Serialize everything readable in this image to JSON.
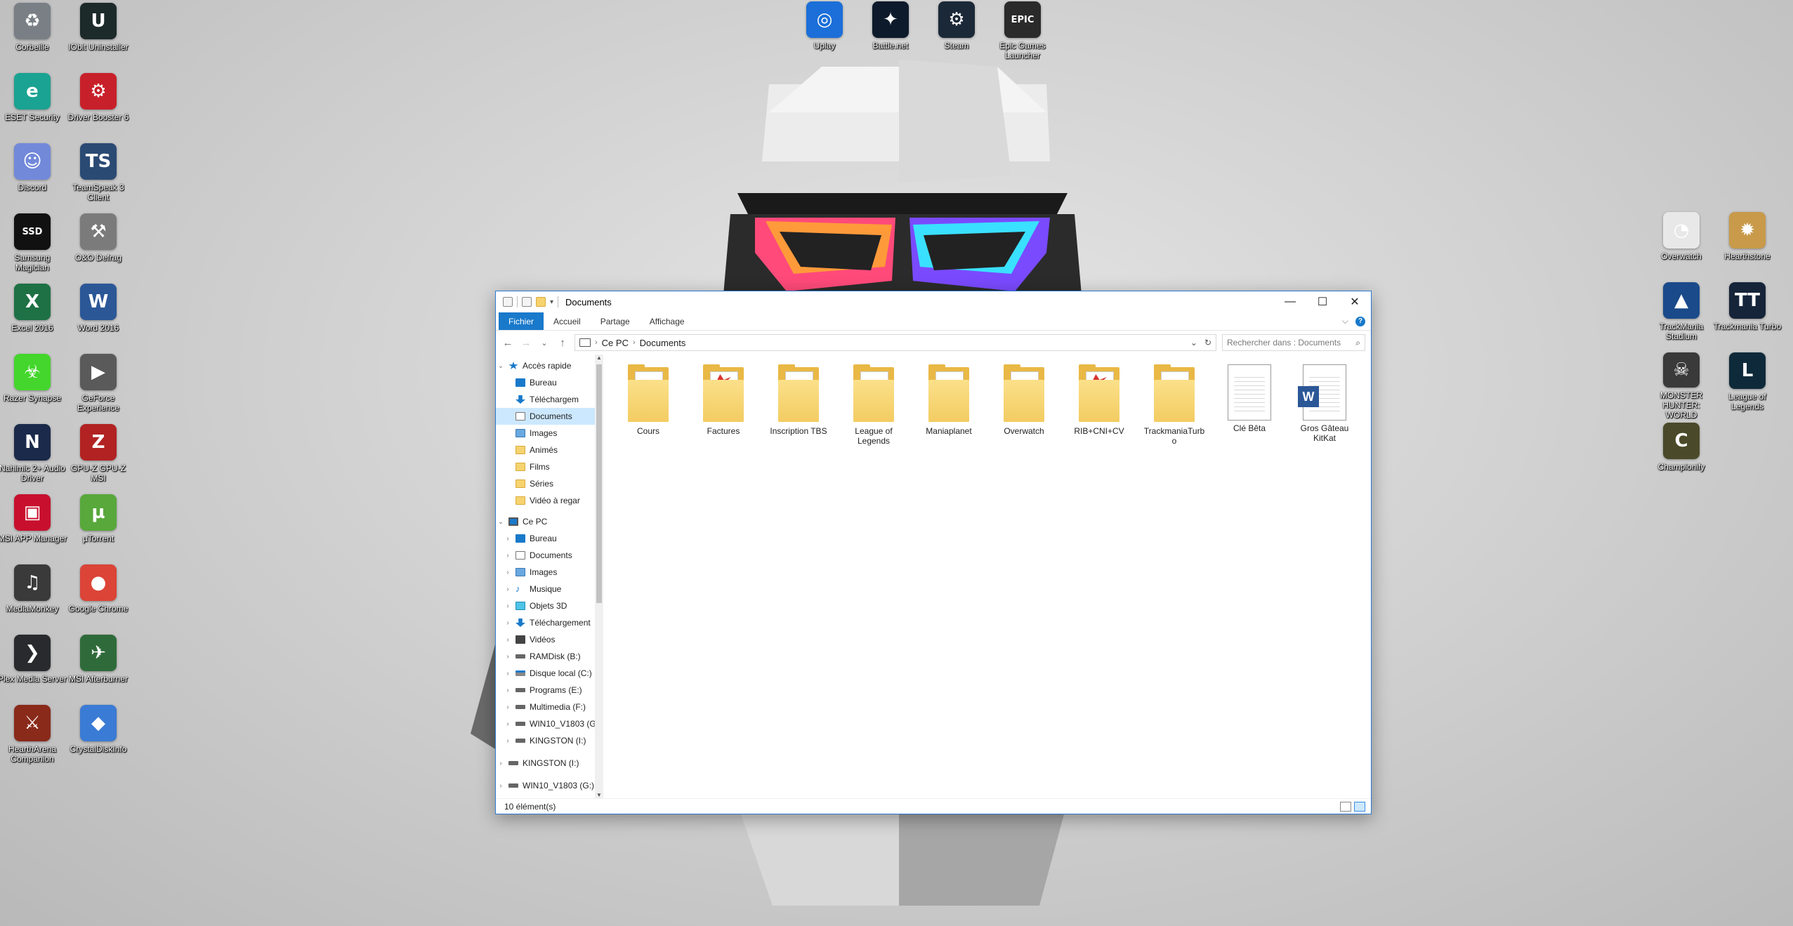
{
  "desktop": {
    "left_icons": [
      {
        "label": "Corbeille",
        "glyph": "♻",
        "color": "#7a7f86",
        "icon": "recycle-bin-icon"
      },
      {
        "label": "IObit Uninstaller",
        "glyph": "U",
        "color": "#1d2a2a",
        "icon": "uninstaller-icon"
      },
      {
        "label": "ESET Security",
        "glyph": "e",
        "color": "#1aa392",
        "icon": "eset-icon"
      },
      {
        "label": "Driver Booster 6",
        "glyph": "⚙",
        "color": "#c8202a",
        "icon": "driver-booster-icon"
      },
      {
        "label": "Discord",
        "glyph": "☺",
        "color": "#7289da",
        "icon": "discord-icon"
      },
      {
        "label": "TeamSpeak 3 Client",
        "glyph": "TS",
        "color": "#2a4a74",
        "icon": "teamspeak-icon"
      },
      {
        "label": "Samsung Magician",
        "glyph": "SSD",
        "color": "#111111",
        "icon": "samsung-magician-icon"
      },
      {
        "label": "O&O Defrag",
        "glyph": "⚒",
        "color": "#7b7b7b",
        "icon": "defrag-icon"
      },
      {
        "label": "Excel 2016",
        "glyph": "X",
        "color": "#1e7145",
        "icon": "excel-icon"
      },
      {
        "label": "Word 2016",
        "glyph": "W",
        "color": "#2b5797",
        "icon": "word-icon"
      },
      {
        "label": "Razer Synapse",
        "glyph": "☣",
        "color": "#44d62c",
        "icon": "razer-synapse-icon"
      },
      {
        "label": "GeForce Experience",
        "glyph": "▶",
        "color": "#5a5a5a",
        "icon": "geforce-icon"
      },
      {
        "label": "Nahimic 2+ Audio Driver",
        "glyph": "N",
        "color": "#1b2a4a",
        "icon": "nahimic-icon"
      },
      {
        "label": "GPU-Z GPU-Z MSI",
        "glyph": "Z",
        "color": "#b22222",
        "icon": "gpu-z-icon"
      },
      {
        "label": "MSI APP Manager",
        "glyph": "▣",
        "color": "#c8102e",
        "icon": "msi-app-manager-icon"
      },
      {
        "label": "µTorrent",
        "glyph": "µ",
        "color": "#58a83b",
        "icon": "utorrent-icon"
      },
      {
        "label": "MediaMonkey",
        "glyph": "♫",
        "color": "#3a3a3a",
        "icon": "mediamonkey-icon"
      },
      {
        "label": "Google Chrome",
        "glyph": "●",
        "color": "#db4437",
        "icon": "chrome-icon"
      },
      {
        "label": "Plex Media Server",
        "glyph": "❯",
        "color": "#282a2d",
        "icon": "plex-icon"
      },
      {
        "label": "MSI Afterburner",
        "glyph": "✈",
        "color": "#2f6b3a",
        "icon": "afterburner-icon"
      },
      {
        "label": "HearthArena Companion",
        "glyph": "⚔",
        "color": "#8a2a1a",
        "icon": "hearth-arena-icon"
      },
      {
        "label": "CrystalDiskInfo",
        "glyph": "◆",
        "color": "#3a7bd5",
        "icon": "crystaldiskinfo-icon"
      }
    ],
    "top_icons": [
      {
        "label": "Uplay",
        "glyph": "◎",
        "color": "#1c6fd8",
        "icon": "uplay-icon"
      },
      {
        "label": "Battle.net",
        "glyph": "✦",
        "color": "#0d1a2b",
        "icon": "battlenet-icon"
      },
      {
        "label": "Steam",
        "glyph": "⚙",
        "color": "#1b2838",
        "icon": "steam-icon"
      },
      {
        "label": "Epic Games Launcher",
        "glyph": "EPIC",
        "color": "#2a2a2a",
        "icon": "epic-games-icon"
      }
    ],
    "right_icons": [
      {
        "label": "Overwatch",
        "glyph": "◔",
        "color": "#e8e8e8",
        "icon": "overwatch-icon"
      },
      {
        "label": "Hearthstone",
        "glyph": "✹",
        "color": "#c89a4a",
        "icon": "hearthstone-icon"
      },
      {
        "label": "TrackMania Stadium",
        "glyph": "▲",
        "color": "#1a4a8a",
        "icon": "trackmania-stadium-icon"
      },
      {
        "label": "Trackmania Turbo",
        "glyph": "TT",
        "color": "#16243a",
        "icon": "trackmania-turbo-icon"
      },
      {
        "label": "MONSTER HUNTER: WORLD",
        "glyph": "☠",
        "color": "#3a3a3a",
        "icon": "monster-hunter-icon"
      },
      {
        "label": "League of Legends",
        "glyph": "L",
        "color": "#0e2a3a",
        "icon": "league-of-legends-icon"
      },
      {
        "label": "Championify",
        "glyph": "C",
        "color": "#4a4a2a",
        "icon": "championify-icon"
      }
    ]
  },
  "window": {
    "title": "Documents",
    "controls": {
      "minimize": "—",
      "maximize": "☐",
      "close": "✕"
    },
    "ribbon": {
      "tabs": [
        "Fichier",
        "Accueil",
        "Partage",
        "Affichage"
      ],
      "expand": "⌵",
      "help": "?"
    },
    "address": {
      "back": "←",
      "forward": "→",
      "recent": "⌄",
      "up": "↑",
      "crumbs": [
        "Ce PC",
        "Documents"
      ],
      "dropdown": "⌄",
      "refresh": "↻",
      "search_placeholder": "Rechercher dans : Documents",
      "search_icon": "⌕"
    },
    "nav": {
      "quick_access": {
        "label": "Accès rapide",
        "items": [
          {
            "label": "Bureau",
            "icon": "blue",
            "pinned": true
          },
          {
            "label": "Téléchargem",
            "icon": "down",
            "pinned": true
          },
          {
            "label": "Documents",
            "icon": "doc",
            "pinned": true,
            "selected": true
          },
          {
            "label": "Images",
            "icon": "img",
            "pinned": true
          },
          {
            "label": "Animés",
            "icon": "folder",
            "pinned": true
          },
          {
            "label": "Films",
            "icon": "folder",
            "pinned": true
          },
          {
            "label": "Séries",
            "icon": "folder",
            "pinned": true
          },
          {
            "label": "Vidéo à regar",
            "icon": "folder",
            "pinned": true
          }
        ]
      },
      "this_pc": {
        "label": "Ce PC",
        "items": [
          {
            "label": "Bureau",
            "icon": "blue"
          },
          {
            "label": "Documents",
            "icon": "doc"
          },
          {
            "label": "Images",
            "icon": "img"
          },
          {
            "label": "Musique",
            "icon": "music"
          },
          {
            "label": "Objets 3D",
            "icon": "cube"
          },
          {
            "label": "Téléchargement",
            "icon": "down"
          },
          {
            "label": "Vidéos",
            "icon": "video"
          },
          {
            "label": "RAMDisk (B:)",
            "icon": "drive"
          },
          {
            "label": "Disque local (C:)",
            "icon": "drivec"
          },
          {
            "label": "Programs (E:)",
            "icon": "drive"
          },
          {
            "label": "Multimedia (F:)",
            "icon": "drive"
          },
          {
            "label": "WIN10_V1803 (G",
            "icon": "drive"
          },
          {
            "label": "KINGSTON (I:)",
            "icon": "drive"
          }
        ]
      },
      "drives": [
        {
          "label": "KINGSTON (I:)",
          "icon": "drive"
        },
        {
          "label": "WIN10_V1803 (G:)",
          "icon": "drive"
        }
      ],
      "pin_glyph": "✶"
    },
    "items": [
      {
        "name": "Cours",
        "type": "folder"
      },
      {
        "name": "Factures",
        "type": "folder-pdf"
      },
      {
        "name": "Inscription TBS",
        "type": "folder"
      },
      {
        "name": "League of Legends",
        "type": "folder"
      },
      {
        "name": "Maniaplanet",
        "type": "folder"
      },
      {
        "name": "Overwatch",
        "type": "folder"
      },
      {
        "name": "RIB+CNI+CV",
        "type": "folder-pdf"
      },
      {
        "name": "TrackmaniaTurbo",
        "type": "folder"
      },
      {
        "name": "Clé Bêta",
        "type": "file"
      },
      {
        "name": "Gros Gâteau KitKat",
        "type": "word"
      }
    ],
    "status": "10 élément(s)"
  }
}
